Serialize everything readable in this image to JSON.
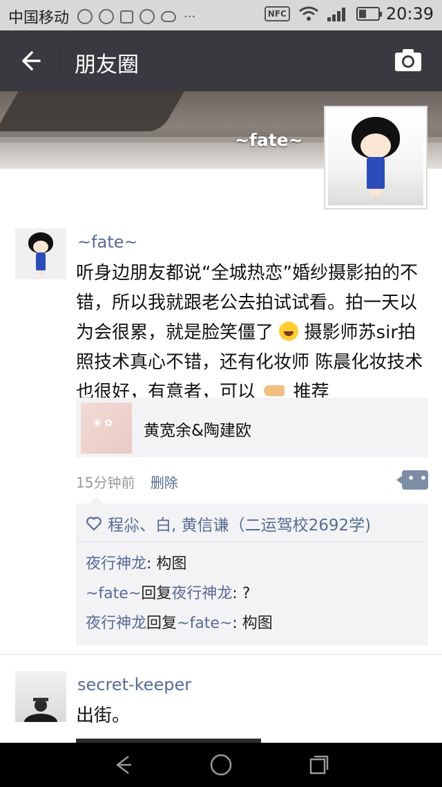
{
  "status_bar": {
    "carrier": "中国移动",
    "more": "···",
    "nfc": "NFC",
    "time": "20:39"
  },
  "header": {
    "title": "朋友圈"
  },
  "profile": {
    "cover_name": "~fate~"
  },
  "posts": [
    {
      "author": "~fate~",
      "text_1": "听身边朋友都说“全城热恋”婚纱摄影拍的不错，所以我就跟老公去拍试试看。拍一天以为会很累，就是脸笑僵了",
      "text_2": "摄影师苏sir拍照技术真心不错，还有化妆师 陈晨化妆技术也很好，有意者，可以",
      "text_3": "推荐",
      "link": {
        "title": "黄宽余&陶建欧"
      },
      "time_ago": "15分钟前",
      "delete_label": "删除",
      "likes": "程尛、白, 黄信谦（二运驾校2692学)",
      "comments": [
        {
          "from": "夜行神龙",
          "sep": ": ",
          "text": "构图"
        },
        {
          "from": "~fate~",
          "mid": "回复",
          "to": "夜行神龙",
          "sep": ": ",
          "text": "?"
        },
        {
          "from": "夜行神龙",
          "mid": "回复",
          "to": "~fate~",
          "sep": ": ",
          "text": "构图"
        }
      ]
    },
    {
      "author": "secret-keeper",
      "text": "出街。"
    }
  ],
  "colors": {
    "title_bar": "#393a3f",
    "link_blue": "#576b95",
    "comment_bg": "#f3f3f5"
  }
}
